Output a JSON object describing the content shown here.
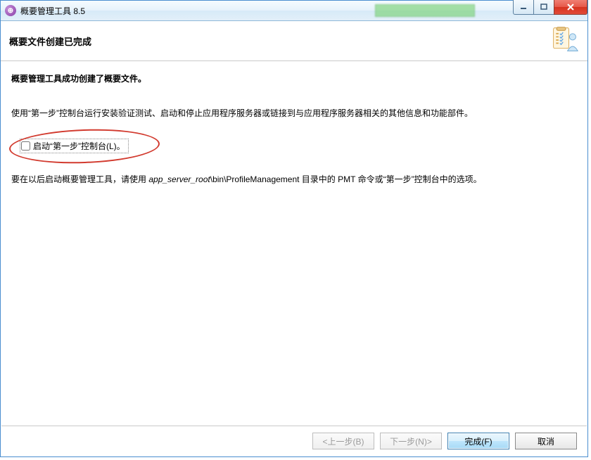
{
  "window": {
    "title": "概要管理工具 8.5"
  },
  "header": {
    "title": "概要文件创建已完成"
  },
  "body": {
    "line1": "概要管理工具成功创建了概要文件。",
    "line2": "使用“第一步”控制台运行安装验证测试、启动和停止应用程序服务器或链接到与应用程序服务器相关的其他信息和功能部件。",
    "checkbox_label": "启动“第一步”控制台(L)。",
    "line3_pre": "要在以后启动概要管理工具，请使用 ",
    "line3_italic": "app_server_root",
    "line3_post": "\\bin\\ProfileManagement 目录中的 PMT 命令或“第一步”控制台中的选项。"
  },
  "buttons": {
    "back": "<上一步(B)",
    "next": "下一步(N)>",
    "finish": "完成(F)",
    "cancel": "取消"
  }
}
